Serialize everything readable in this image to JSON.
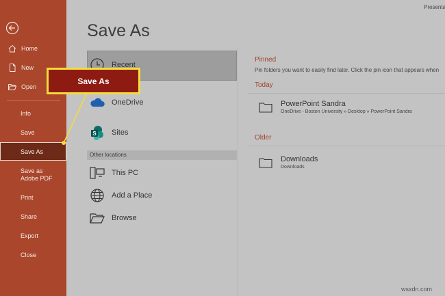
{
  "sidebar": {
    "items": [
      {
        "label": "Home",
        "icon": "home-icon"
      },
      {
        "label": "New",
        "icon": "new-document-icon"
      },
      {
        "label": "Open",
        "icon": "folder-open-icon"
      },
      {
        "label": "Info"
      },
      {
        "label": "Save"
      },
      {
        "label": "Save As",
        "active": true
      },
      {
        "label": "Save as Adobe PDF"
      },
      {
        "label": "Print"
      },
      {
        "label": "Share"
      },
      {
        "label": "Export"
      },
      {
        "label": "Close"
      }
    ],
    "background": "#a9462b",
    "active_background": "#6e2a19"
  },
  "header": {
    "title": "Save As",
    "app_title": "Presentat"
  },
  "locations": {
    "recent": "Recent",
    "onedrive": "OneDrive",
    "sites": "Sites",
    "other_locations": "Other locations",
    "this_pc": "This PC",
    "add_place": "Add a Place",
    "browse": "Browse"
  },
  "files": {
    "pinned_heading": "Pinned",
    "pinned_desc": "Pin folders you want to easily find later. Click the pin icon that appears when",
    "today_heading": "Today",
    "today": [
      {
        "name": "PowerPoint Sandra",
        "path": "OneDrive - Boston University » Desktop » PowerPoint Sandra"
      }
    ],
    "older_heading": "Older",
    "older": [
      {
        "name": "Downloads",
        "path": "Downloads"
      }
    ],
    "accent": "#a0432b"
  },
  "callout": {
    "label": "Save As",
    "border_color": "#f4dc3a",
    "fill_color": "#8e1b12"
  },
  "watermark": "wsxdn.com"
}
